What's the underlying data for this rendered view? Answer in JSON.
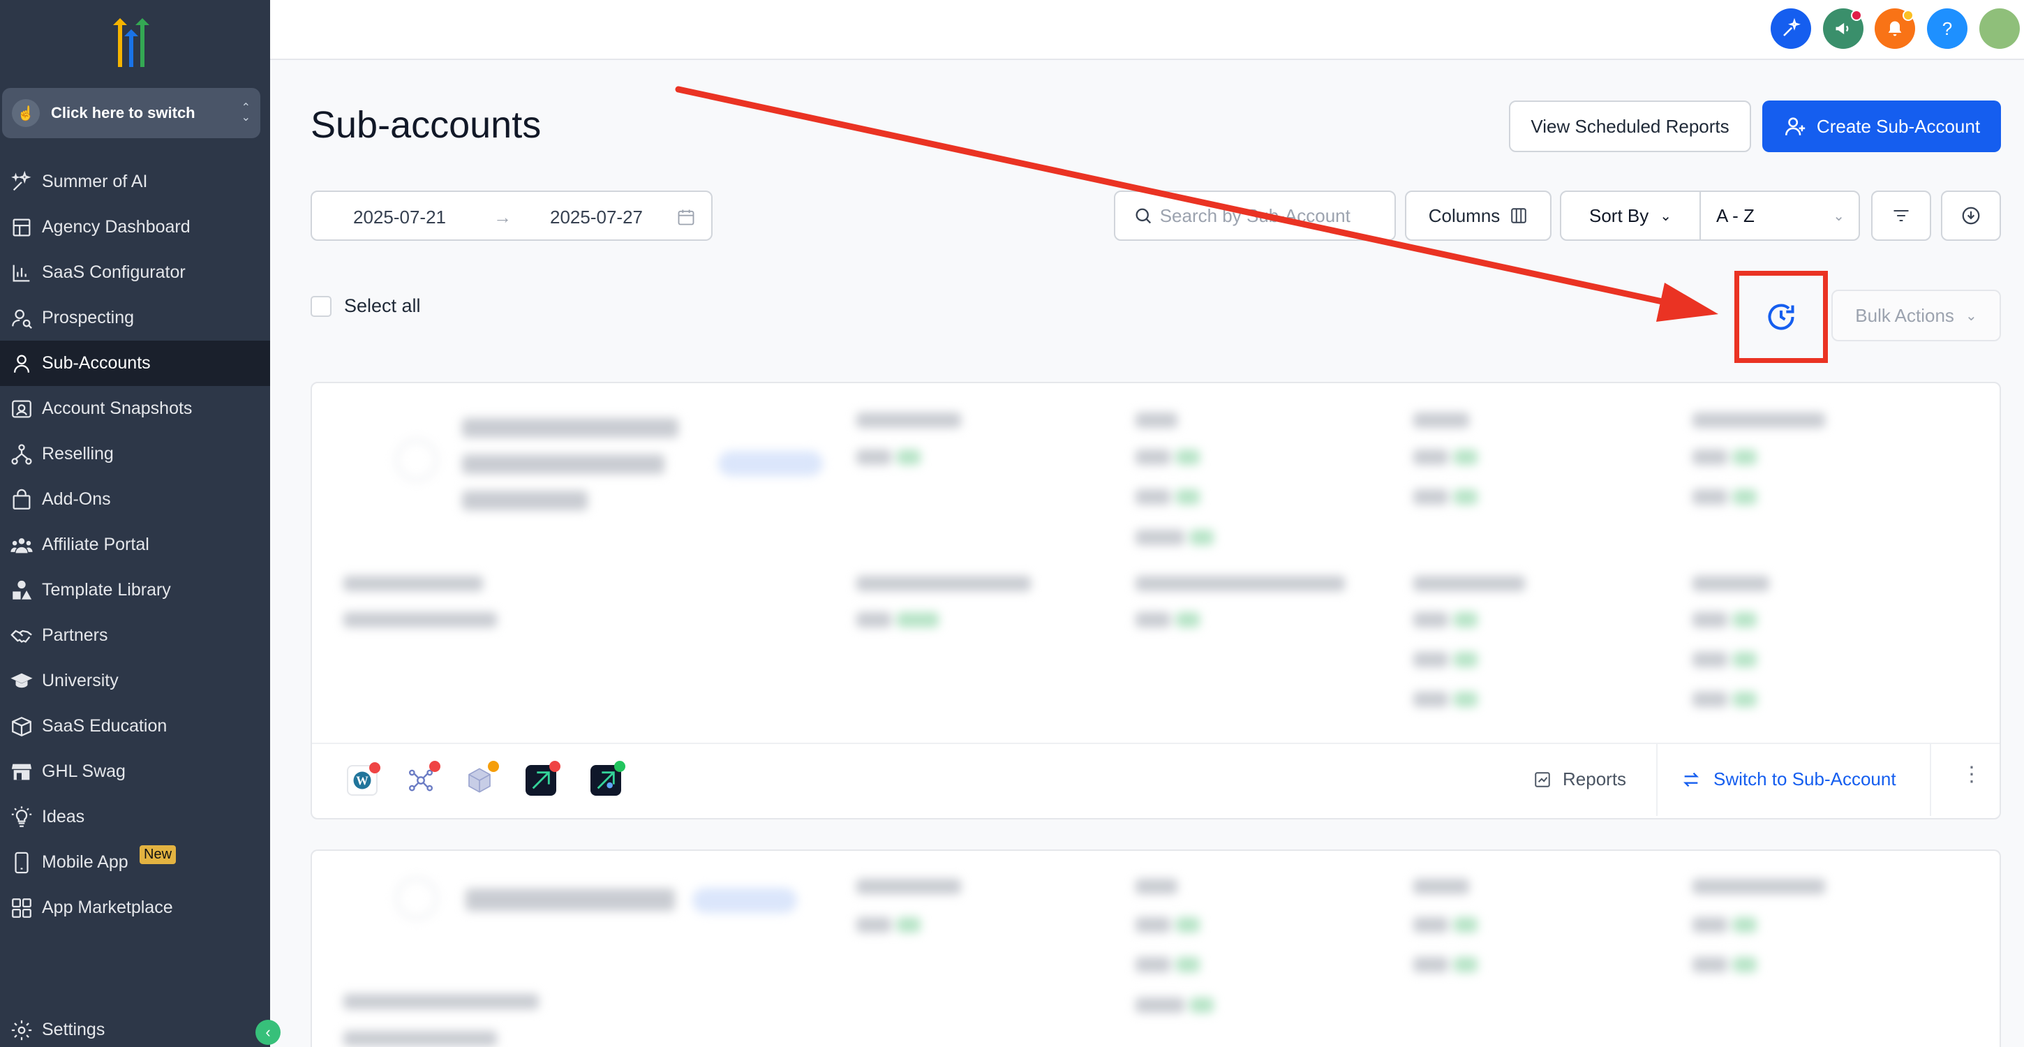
{
  "sidebar": {
    "switcher_label": "Click here to switch",
    "items": [
      {
        "label": "Summer of AI",
        "icon": "sparkle-icon"
      },
      {
        "label": "Agency Dashboard",
        "icon": "dashboard-icon"
      },
      {
        "label": "SaaS Configurator",
        "icon": "chart-icon"
      },
      {
        "label": "Prospecting",
        "icon": "user-search-icon"
      },
      {
        "label": "Sub-Accounts",
        "icon": "user-icon",
        "active": true
      },
      {
        "label": "Account Snapshots",
        "icon": "snapshot-icon"
      },
      {
        "label": "Reselling",
        "icon": "network-icon"
      },
      {
        "label": "Add-Ons",
        "icon": "bag-icon"
      },
      {
        "label": "Affiliate Portal",
        "icon": "users-icon"
      },
      {
        "label": "Template Library",
        "icon": "shapes-icon"
      },
      {
        "label": "Partners",
        "icon": "handshake-icon"
      },
      {
        "label": "University",
        "icon": "graduation-cap-icon"
      },
      {
        "label": "SaaS Education",
        "icon": "box-icon"
      },
      {
        "label": "GHL Swag",
        "icon": "store-icon"
      },
      {
        "label": "Ideas",
        "icon": "lightbulb-icon"
      },
      {
        "label": "Mobile App",
        "icon": "phone-icon",
        "badge": "New"
      },
      {
        "label": "App Marketplace",
        "icon": "grid-icon"
      }
    ],
    "settings_label": "Settings"
  },
  "topbar": {
    "icons": [
      "ai-sparkle-icon",
      "megaphone-icon",
      "bell-icon",
      "help-icon",
      "avatar"
    ],
    "colors": {
      "ai": "#155eef",
      "megaphone": "#3a8f6b",
      "bell": "#f97316",
      "help": "#1e90ff"
    }
  },
  "header": {
    "title": "Sub-accounts",
    "view_reports_label": "View Scheduled Reports",
    "create_label": "Create Sub-Account"
  },
  "filters": {
    "date_start": "2025-07-21",
    "date_end": "2025-07-27",
    "search_placeholder": "Search by Sub-Account",
    "columns_label": "Columns",
    "sort_by_label": "Sort By",
    "sort_value": "A - Z"
  },
  "list": {
    "select_all_label": "Select all",
    "bulk_actions_label": "Bulk Actions"
  },
  "card": {
    "reports_label": "Reports",
    "switch_label": "Switch to Sub-Account"
  },
  "colors": {
    "primary": "#155eef",
    "annotation_red": "#ea3323",
    "sidebar_bg": "#2d3748"
  }
}
